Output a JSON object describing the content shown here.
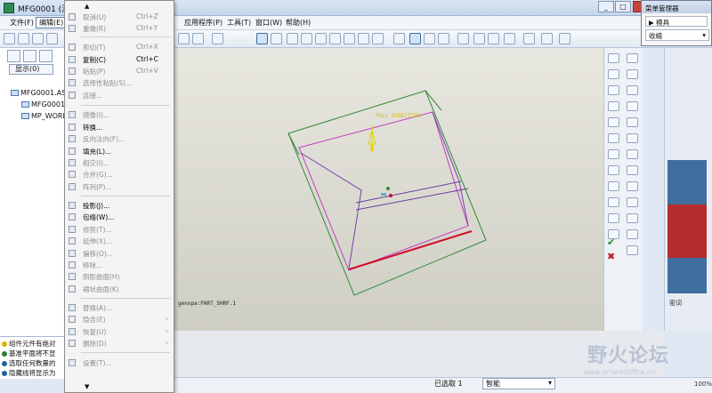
{
  "window": {
    "title": "MFG0001 (活动",
    "close_label": "x"
  },
  "menubar": {
    "items": [
      "文件(F)",
      "编辑(E)",
      "应用程序(P)",
      "工具(T)",
      "窗口(W)",
      "帮助(H)"
    ]
  },
  "left_panel": {
    "show_label": "显示(0)",
    "tree": [
      "MFG0001.ASM",
      "MFG0001_",
      "MP_WORK"
    ]
  },
  "messages": [
    "组件元件有绝对",
    "基准平面将不显",
    "选取任何数量的",
    "隐藏线将显示为"
  ],
  "edit_menu": {
    "items": [
      {
        "label": "取消(U)",
        "shortcut": "Ctrl+Z",
        "enabled": false
      },
      {
        "label": "重做(R)",
        "shortcut": "Ctrl+Y",
        "enabled": false
      },
      {
        "label": "剪切(T)",
        "shortcut": "Ctrl+X",
        "enabled": false
      },
      {
        "label": "复制(C)",
        "shortcut": "Ctrl+C",
        "enabled": true
      },
      {
        "label": "粘贴(P)",
        "shortcut": "Ctrl+V",
        "enabled": false
      },
      {
        "label": "选择性粘贴(S)...",
        "shortcut": "",
        "enabled": false
      },
      {
        "label": "连接...",
        "shortcut": "",
        "enabled": false
      },
      {
        "label": "镜像(I)...",
        "shortcut": "",
        "enabled": false
      },
      {
        "label": "转换...",
        "shortcut": "",
        "enabled": true
      },
      {
        "label": "反向法向(F)...",
        "shortcut": "",
        "enabled": false
      },
      {
        "label": "填充(L)...",
        "shortcut": "",
        "enabled": true
      },
      {
        "label": "相交(I)...",
        "shortcut": "",
        "enabled": false
      },
      {
        "label": "合并(G)...",
        "shortcut": "",
        "enabled": false
      },
      {
        "label": "阵列(P)...",
        "shortcut": "",
        "enabled": false
      },
      {
        "label": "投影(J)...",
        "shortcut": "",
        "enabled": true
      },
      {
        "label": "包络(W)...",
        "shortcut": "",
        "enabled": true
      },
      {
        "label": "修剪(T)...",
        "shortcut": "",
        "enabled": false
      },
      {
        "label": "延伸(X)...",
        "shortcut": "",
        "enabled": false
      },
      {
        "label": "偏移(O)...",
        "shortcut": "",
        "enabled": false
      },
      {
        "label": "移除...",
        "shortcut": "",
        "enabled": false
      },
      {
        "label": "阴影曲面(H)",
        "shortcut": "",
        "enabled": false
      },
      {
        "label": "裙状曲面(K)",
        "shortcut": "",
        "enabled": false
      },
      {
        "label": "替换(A)...",
        "shortcut": "",
        "enabled": false
      },
      {
        "label": "隐含(E)",
        "shortcut": "",
        "enabled": false,
        "submenu": true
      },
      {
        "label": "恢复(U)",
        "shortcut": "",
        "enabled": false,
        "submenu": true
      },
      {
        "label": "删除(D)",
        "shortcut": "",
        "enabled": false,
        "submenu": true
      },
      {
        "label": "设置(T)...",
        "shortcut": "",
        "enabled": false
      }
    ]
  },
  "graphics": {
    "pull_direction_label": "PULL DIRECTION",
    "part_label": "genxpa:PART_5HRF.1"
  },
  "menu_manager": {
    "title": "菜单管理器",
    "item": "模具",
    "select": "收缩"
  },
  "statusbar": {
    "selection": "已选取 1",
    "filter": "智能",
    "zoom": "100%"
  },
  "side_strip": {
    "label": "密词"
  },
  "watermark": {
    "text": "野火论坛",
    "url": "www.proewildfire.cn"
  }
}
